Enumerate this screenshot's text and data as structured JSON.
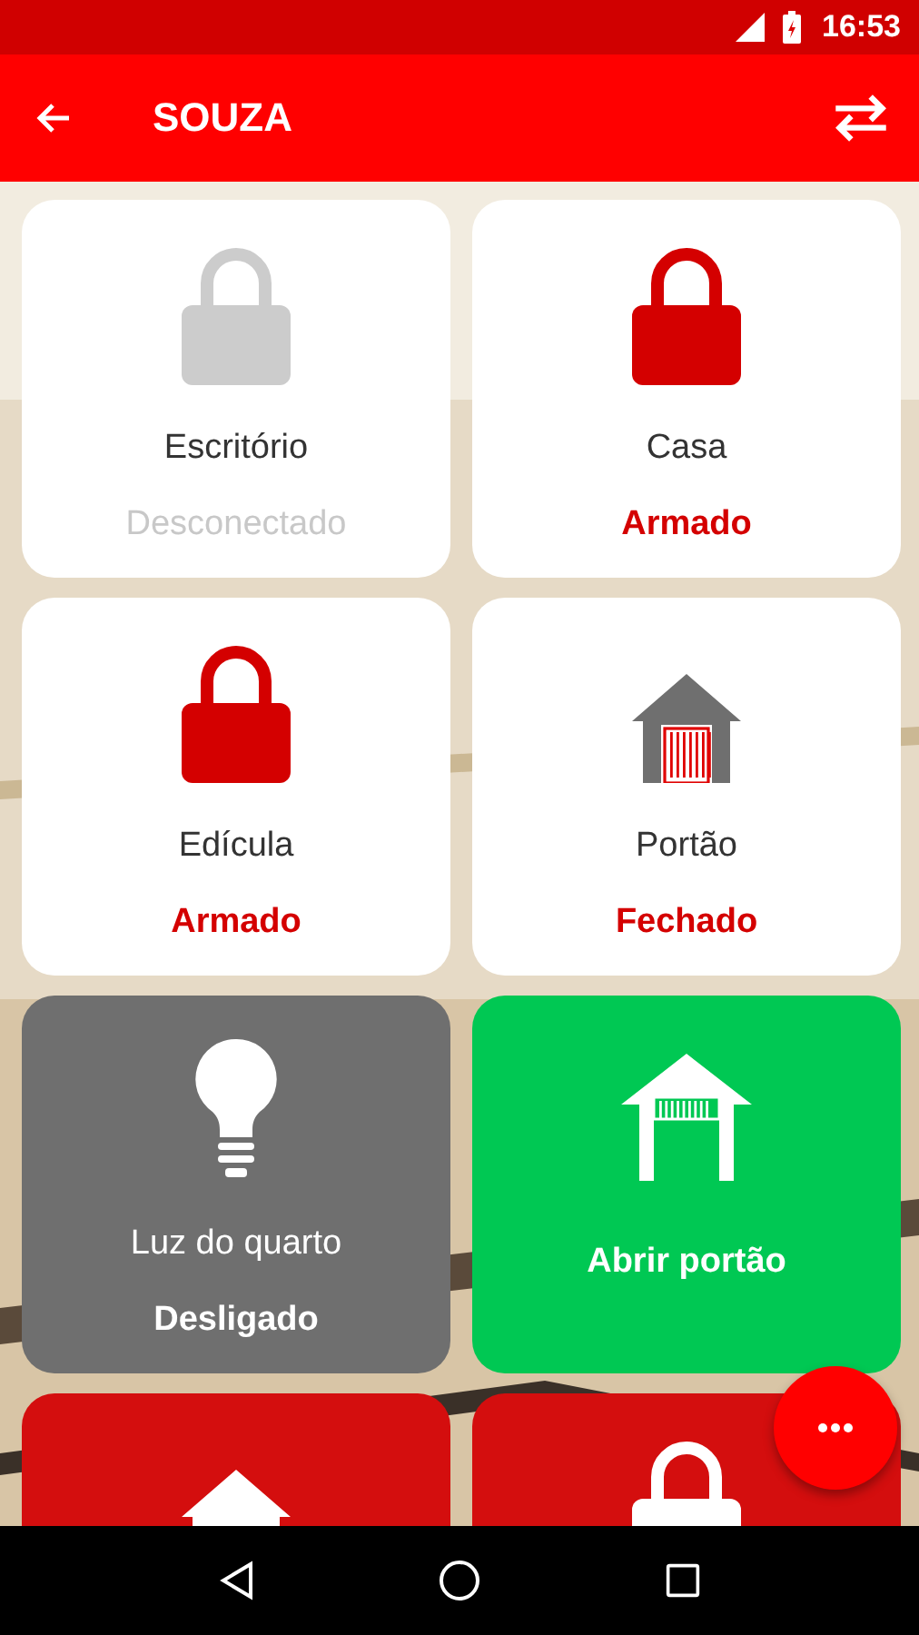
{
  "status_bar": {
    "time": "16:53"
  },
  "app_bar": {
    "title": "SOUZA"
  },
  "cards": [
    {
      "kind": "lock",
      "color": "#ffffff",
      "connected": false,
      "name": "Escritório",
      "status": "Desconectado"
    },
    {
      "kind": "lock",
      "color": "#ffffff",
      "connected": true,
      "name": "Casa",
      "status": "Armado"
    },
    {
      "kind": "lock",
      "color": "#ffffff",
      "connected": true,
      "name": "Edícula",
      "status": "Armado"
    },
    {
      "kind": "garage",
      "color": "#ffffff",
      "connected": true,
      "name": "Portão",
      "status": "Fechado"
    },
    {
      "kind": "bulb",
      "color": "#6f6f6f",
      "name": "Luz do quarto",
      "status": "Desligado"
    },
    {
      "kind": "gate",
      "color": "#00c853",
      "name": "Abrir portão"
    },
    {
      "kind": "garage",
      "color": "#d40e0e"
    },
    {
      "kind": "lock",
      "color": "#d40e0e"
    }
  ]
}
